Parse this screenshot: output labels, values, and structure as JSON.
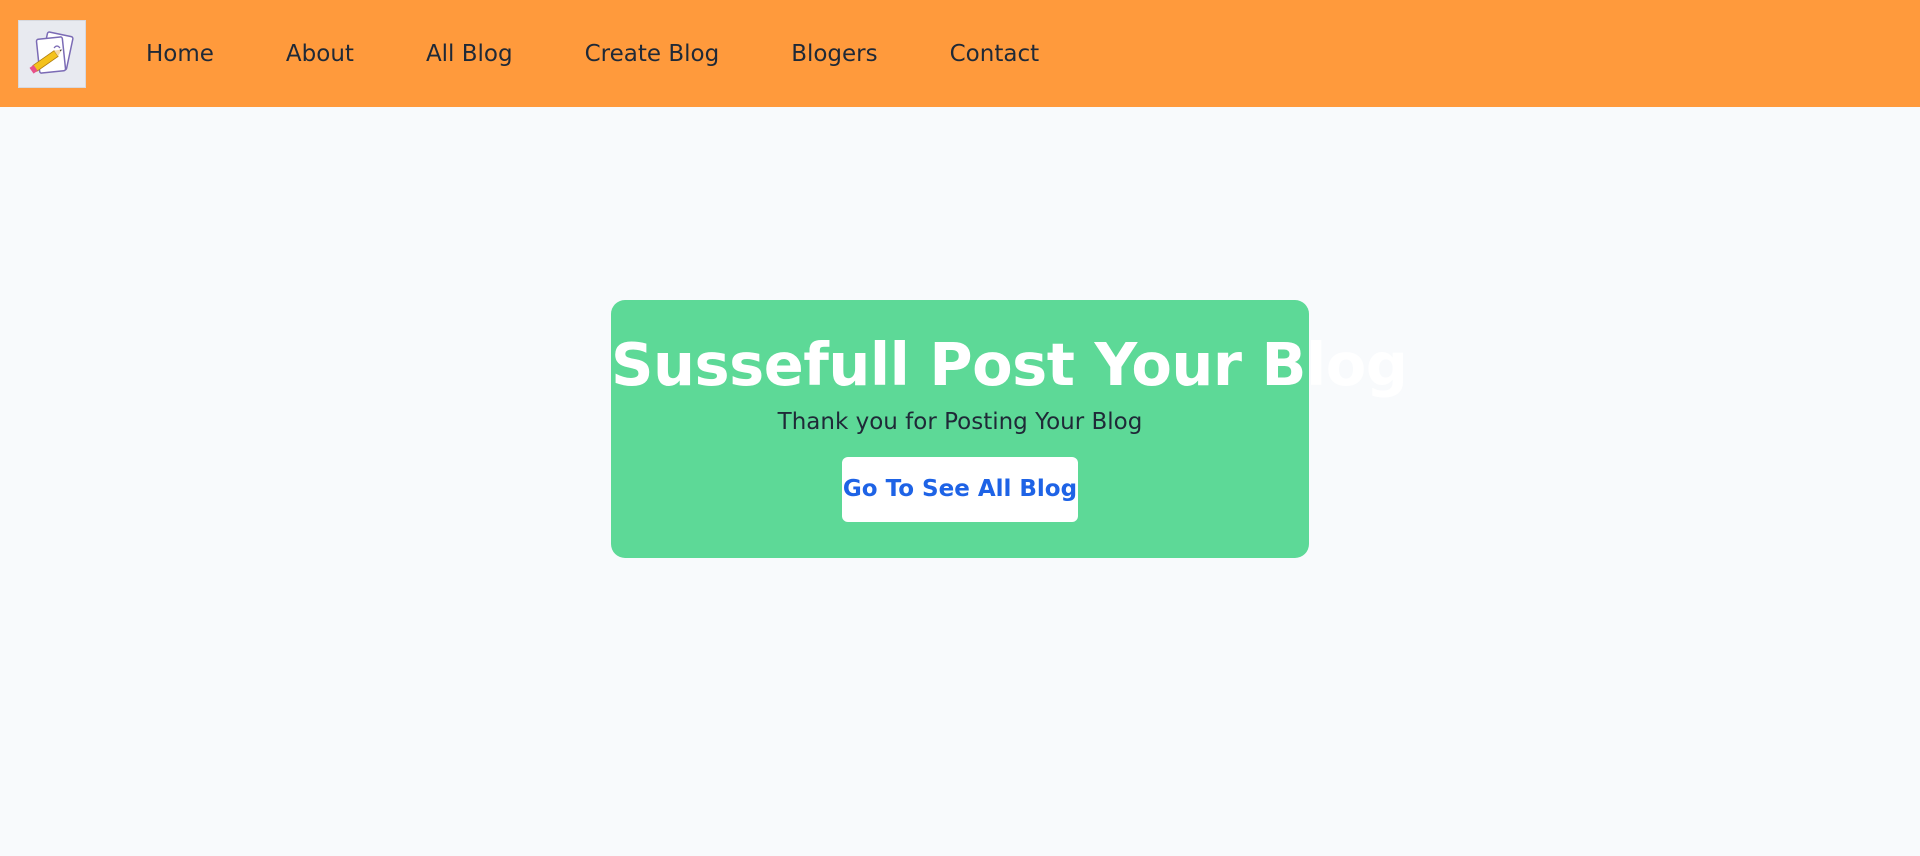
{
  "colors": {
    "navbar_bg": "#ff9a3c",
    "page_bg": "#f8fafc",
    "card_bg": "#5dd997",
    "button_text": "#1e63e6"
  },
  "navbar": {
    "logo_icon": "notepad-pencil-icon",
    "links": [
      {
        "label": "Home"
      },
      {
        "label": "About"
      },
      {
        "label": "All Blog"
      },
      {
        "label": "Create Blog"
      },
      {
        "label": "Blogers"
      },
      {
        "label": "Contact"
      }
    ]
  },
  "success_card": {
    "title": "Sussefull Post Your Blog",
    "subtitle": "Thank you for Posting Your Blog",
    "button_label": "Go To See All Blog"
  }
}
